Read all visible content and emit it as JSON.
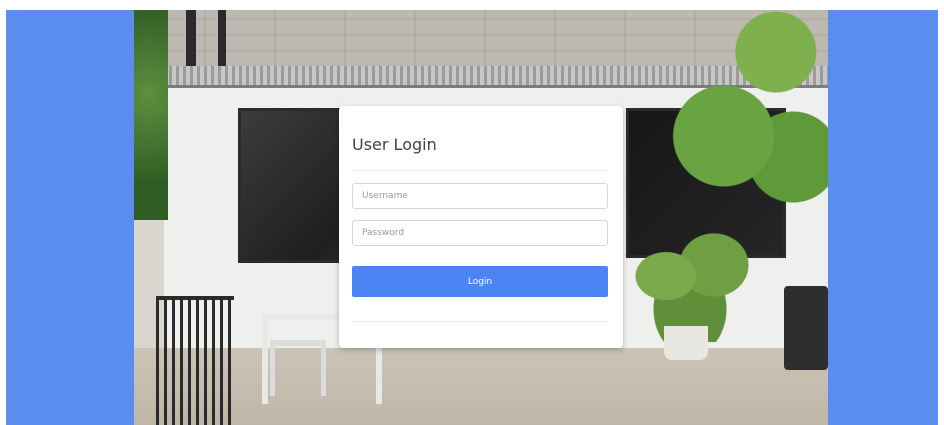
{
  "login": {
    "title": "User Login",
    "username_placeholder": "Username",
    "password_placeholder": "Password",
    "button_label": "Login"
  },
  "colors": {
    "side_panel": "#5b8def",
    "button": "#4d84f4",
    "card": "#ffffff"
  }
}
